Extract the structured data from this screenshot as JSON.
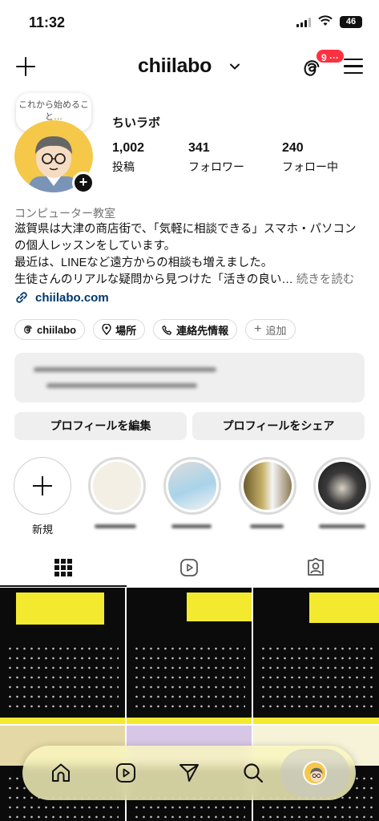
{
  "status_bar": {
    "time": "11:32",
    "battery": "46"
  },
  "header": {
    "username": "chiilabo",
    "notification_count": "9",
    "notification_more": "···"
  },
  "profile": {
    "note": "これから始めること…",
    "display_name": "ちいラボ",
    "stats": [
      {
        "value": "1,002",
        "label": "投稿"
      },
      {
        "value": "341",
        "label": "フォロワー"
      },
      {
        "value": "240",
        "label": "フォロー中"
      }
    ],
    "category": "コンピューター教室",
    "bio_lines": [
      "滋賀県は大津の商店街で、「気軽に相談できる」スマホ・パソコン",
      "の個人レッスンをしています。",
      "最近は、LINEなど遠方からの相談も増えました。",
      "生徒さんのリアルな疑問から見つけた「活きの良い…"
    ],
    "bio_more": "続きを読む",
    "link": "chiilabo.com"
  },
  "chips": [
    {
      "label": "chiilabo"
    },
    {
      "label": "場所"
    },
    {
      "label": "連絡先情報"
    },
    {
      "label": "追加"
    }
  ],
  "buttons": {
    "edit_profile": "プロフィールを編集",
    "share_profile": "プロフィールをシェア"
  },
  "highlights": {
    "new_label": "新規"
  },
  "tabs": [
    "grid",
    "reels",
    "tagged"
  ],
  "bottom_nav": [
    "home",
    "reels",
    "send",
    "search",
    "profile"
  ],
  "colors": {
    "badge": "#ff3040",
    "link": "#00376b",
    "grid_yellow": "#f3ea2f"
  }
}
